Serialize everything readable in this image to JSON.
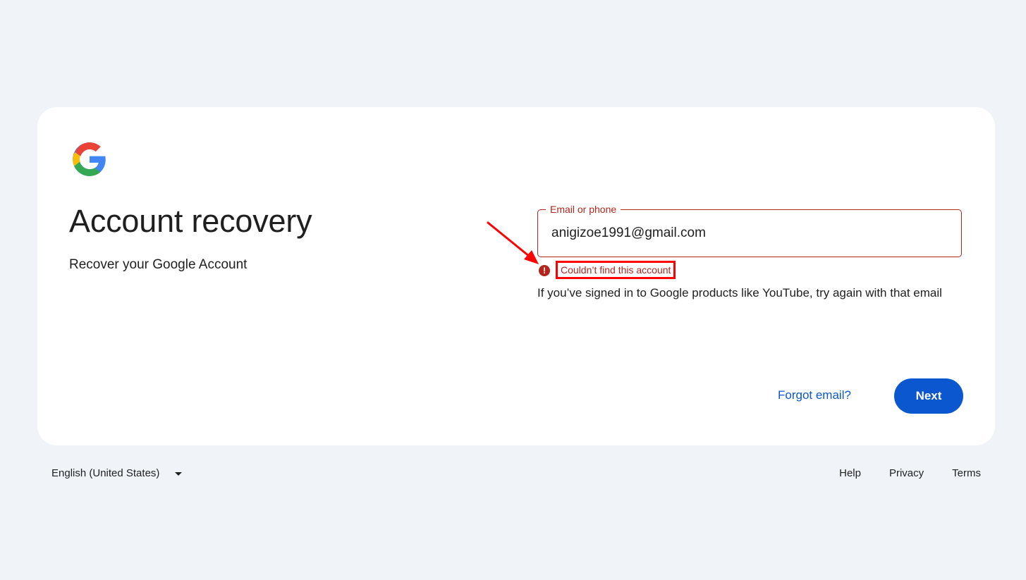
{
  "logo": {
    "name": "Google"
  },
  "heading": {
    "title": "Account recovery",
    "subtitle": "Recover your Google Account"
  },
  "field": {
    "label": "Email or phone",
    "value": "anigizoe1991@gmail.com"
  },
  "error": {
    "icon": "!",
    "message": "Couldn’t find this account"
  },
  "hint": "If you’ve signed in to Google products like YouTube, try again with that email",
  "actions": {
    "forgot_label": "Forgot email?",
    "next_label": "Next"
  },
  "footer": {
    "language": "English (United States)",
    "links": [
      "Help",
      "Privacy",
      "Terms"
    ]
  },
  "colors": {
    "background": "#f0f4f9",
    "error": "#b3261e",
    "primary": "#0b57d0",
    "annotation": "#ff0000"
  }
}
